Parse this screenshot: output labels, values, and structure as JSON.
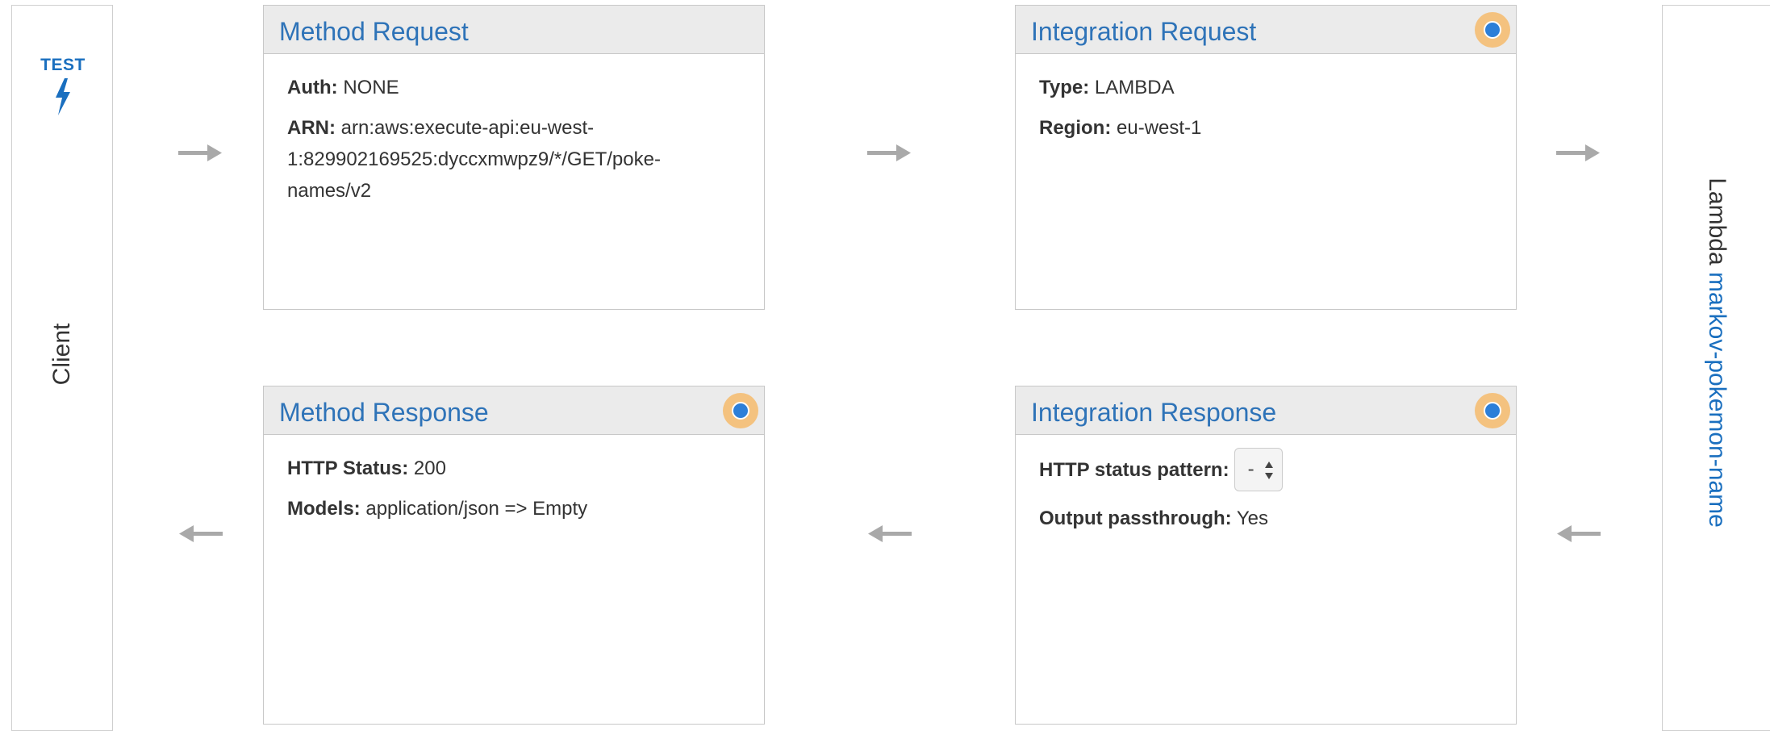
{
  "client": {
    "test_label": "TEST",
    "label": "Client"
  },
  "lambda": {
    "prefix": "Lambda",
    "function_name": "markov-pokemon-name"
  },
  "method_request": {
    "title": "Method Request",
    "auth_key": "Auth:",
    "auth_value": "NONE",
    "arn_key": "ARN:",
    "arn_value": "arn:aws:execute-api:eu-west-1:829902169525:dyccxmwpz9/*/GET/poke-names/v2"
  },
  "integration_request": {
    "title": "Integration Request",
    "type_key": "Type:",
    "type_value": "LAMBDA",
    "region_key": "Region:",
    "region_value": "eu-west-1"
  },
  "method_response": {
    "title": "Method Response",
    "status_key": "HTTP Status:",
    "status_value": "200",
    "models_key": "Models:",
    "models_value": "application/json => Empty"
  },
  "integration_response": {
    "title": "Integration Response",
    "pattern_key": "HTTP status pattern:",
    "pattern_value": "-",
    "passthrough_key": "Output passthrough:",
    "passthrough_value": "Yes"
  },
  "icons": {
    "test": "lightning-bolt-icon",
    "status_dot": "status-dot-icon",
    "arrow_right": "arrow-right-icon",
    "arrow_left": "arrow-left-icon"
  },
  "colors": {
    "link_blue": "#2e73b8",
    "test_blue": "#1a6fbf",
    "dot_outer": "#f4c27f",
    "dot_inner": "#2d7fd8",
    "arrow_gray": "#a9a9a9",
    "header_bg": "#ebebeb"
  }
}
